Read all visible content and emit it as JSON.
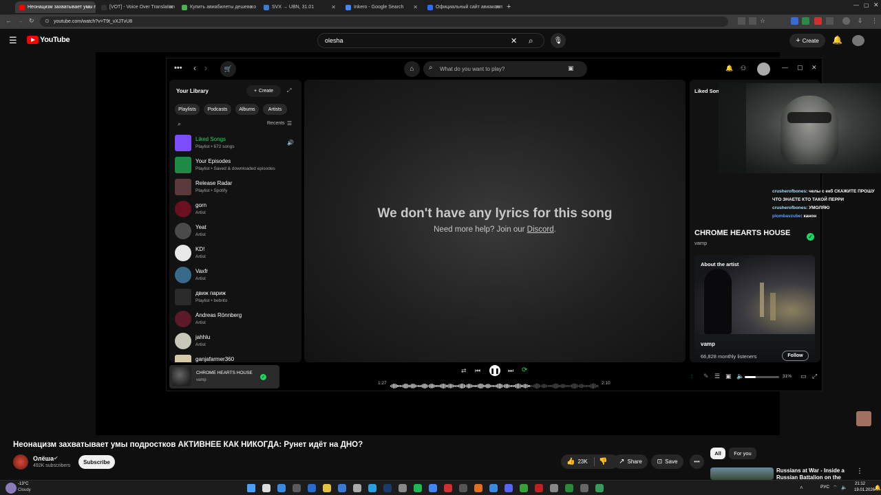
{
  "browser": {
    "tabs": [
      {
        "title": "Неонацизм захватывает умы п",
        "active": true,
        "color": "#ff0000"
      },
      {
        "title": "[VOT] - Voice Over Translation",
        "active": false,
        "color": "#333333"
      },
      {
        "title": "Купить авиабилеты дешево о",
        "active": false,
        "color": "#4caf50"
      },
      {
        "title": "SVX → UBN, 31.01",
        "active": false,
        "color": "#3a7bd5"
      },
      {
        "title": "Inkero - Google Search",
        "active": false,
        "color": "#4285f4"
      },
      {
        "title": "Официальный сайт авиакомп",
        "active": false,
        "color": "#2b6cff"
      }
    ],
    "url": "youtube.com/watch?v=T9t_vXJTvU8"
  },
  "youtube": {
    "logo_text": "YouTube",
    "search_value": "olesha",
    "create_label": "Create",
    "video_title": "Неонацизм захватывает умы подростков АКТИВНЕЕ КАК НИКОГДА: Рунет идёт на ДНО?",
    "channel_name": "Олёша",
    "subscribers": "492K subscribers",
    "subscribe_label": "Subscribe",
    "likes": "23K",
    "share_label": "Share",
    "save_label": "Save",
    "filter_all": "All",
    "filter_for_you": "For you",
    "recommended_title": "Russians at War - Inside a Russian Battalion on the Front"
  },
  "spotify": {
    "search_placeholder": "What do you want to play?",
    "library_title": "Your Library",
    "create_label": "Create",
    "chips": [
      "Playlists",
      "Podcasts",
      "Albums",
      "Artists"
    ],
    "recents_label": "Recents",
    "library_items": [
      {
        "title": "Liked Songs",
        "subtitle": "Playlist • 672 songs",
        "color": "#7b4dff",
        "round": false,
        "green": true
      },
      {
        "title": "Your Episodes",
        "subtitle": "Playlist • Saved & downloaded episodes",
        "color": "#1e8a45",
        "round": false,
        "green": false
      },
      {
        "title": "Release Radar",
        "subtitle": "Playlist • Spotify",
        "color": "#5a3a3a",
        "round": false,
        "green": false
      },
      {
        "title": "gorn",
        "subtitle": "Artist",
        "color": "#6b1020",
        "round": true,
        "green": false
      },
      {
        "title": "Yeat",
        "subtitle": "Artist",
        "color": "#4a4a4a",
        "round": true,
        "green": false
      },
      {
        "title": "KD!",
        "subtitle": "Artist",
        "color": "#e8e8e8",
        "round": true,
        "green": false
      },
      {
        "title": "Vaxfr",
        "subtitle": "Artist",
        "color": "#3a6a8a",
        "round": true,
        "green": false
      },
      {
        "title": "движ париж",
        "subtitle": "Playlist • bebrito",
        "color": "#2a2a2a",
        "round": false,
        "green": false
      },
      {
        "title": "Andreas Rönnberg",
        "subtitle": "Artist",
        "color": "#5a1a2a",
        "round": true,
        "green": false
      },
      {
        "title": "jahhlu",
        "subtitle": "Artist",
        "color": "#c8c8b8",
        "round": true,
        "green": false
      },
      {
        "title": "ganjafarmer360",
        "subtitle": "",
        "color": "#d8c8a8",
        "round": false,
        "green": false
      }
    ],
    "lyrics_message": "We don't have any lyrics for this song",
    "lyrics_help": "Need more help? Join our",
    "lyrics_link": "Discord",
    "right_panel_header": "Liked Songs",
    "track_title": "CHROME HEARTS HOUSE",
    "track_artist": "vamp",
    "about_artist_label": "About the artist",
    "artist_name": "vamp",
    "monthly_listeners": "66,828 monthly listeners",
    "follow_label": "Follow",
    "now_playing_title": "CHROME HEARTS HOUSE",
    "now_playing_artist": "vamp",
    "time_elapsed": "1:27",
    "time_total": "2:10",
    "progress": 0.67,
    "volume_label": "31%",
    "volume": 0.31
  },
  "stream_overlay": {
    "chat": [
      {
        "user": "crusherofbones",
        "text": ": челы с екб СКАЖИТЕ ПРОШУ ЧТО ЗНАЕТЕ КТО ТАКОЙ ПЕРРИ",
        "color": "#a0e0ff"
      },
      {
        "user": "crusherofbones",
        "text": ": УМОЛЯЮ",
        "color": "#a0e0ff"
      },
      {
        "user": "plombavzube",
        "text": ": канон",
        "color": "#5aa0ff"
      }
    ]
  },
  "taskbar": {
    "weather_temp": "-13°C",
    "weather_desc": "Cloudy",
    "lang": "РУС",
    "time": "21:12",
    "date": "19.01.2026"
  }
}
